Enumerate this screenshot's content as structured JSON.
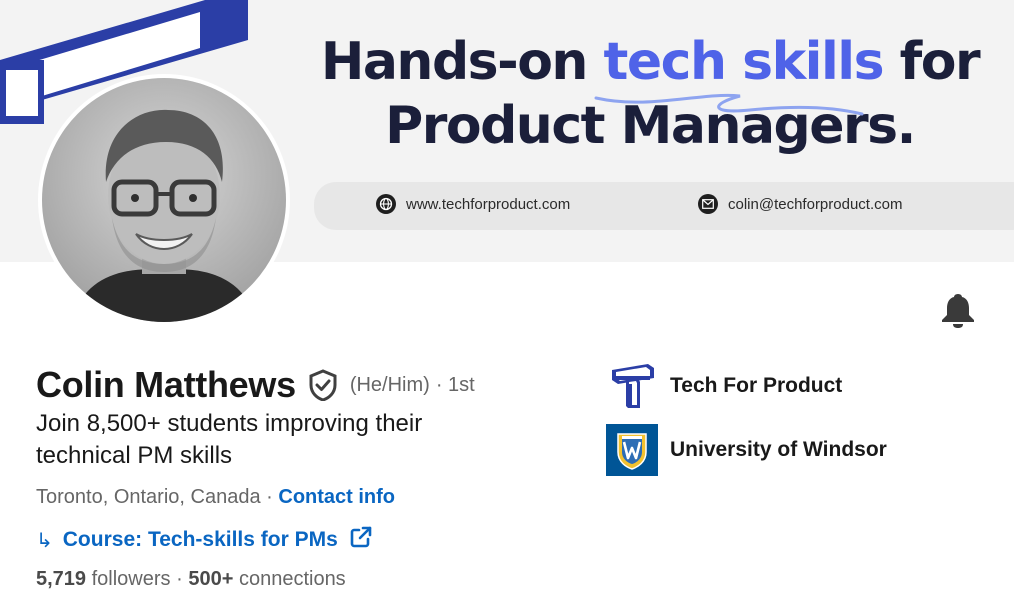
{
  "banner": {
    "headline_part1": "Hands-on ",
    "headline_accent": "tech skills",
    "headline_part2": " for",
    "headline_line2": "Product Managers.",
    "website": "www.techforproduct.com",
    "email": "colin@techforproduct.com",
    "accent_color": "#4f63e8",
    "logo_color": "#2b3ea6",
    "website_icon": "globe-icon",
    "email_icon": "mail-icon"
  },
  "profile": {
    "name": "Colin Matthews",
    "verified_icon": "verified-shield-icon",
    "pronouns": "(He/Him)",
    "degree": "· 1st",
    "tagline": "Join 8,500+ students improving their technical PM skills",
    "location": "Toronto, Ontario, Canada",
    "location_separator": " · ",
    "contact_info_label": "Contact info",
    "course_arrow": "↳",
    "course_label": "Course: Tech-skills for PMs",
    "followers_count": "5,719",
    "followers_label": " followers",
    "stats_separator": " · ",
    "connections_count": "500+",
    "connections_label": " connections",
    "link_color": "#0a66c2"
  },
  "experience": {
    "company": "Tech For Product",
    "company_logo": "tech-for-product-logo",
    "school": "University of Windsor",
    "school_logo": "university-of-windsor-crest"
  },
  "actions": {
    "bell_icon": "notification-bell-icon"
  }
}
